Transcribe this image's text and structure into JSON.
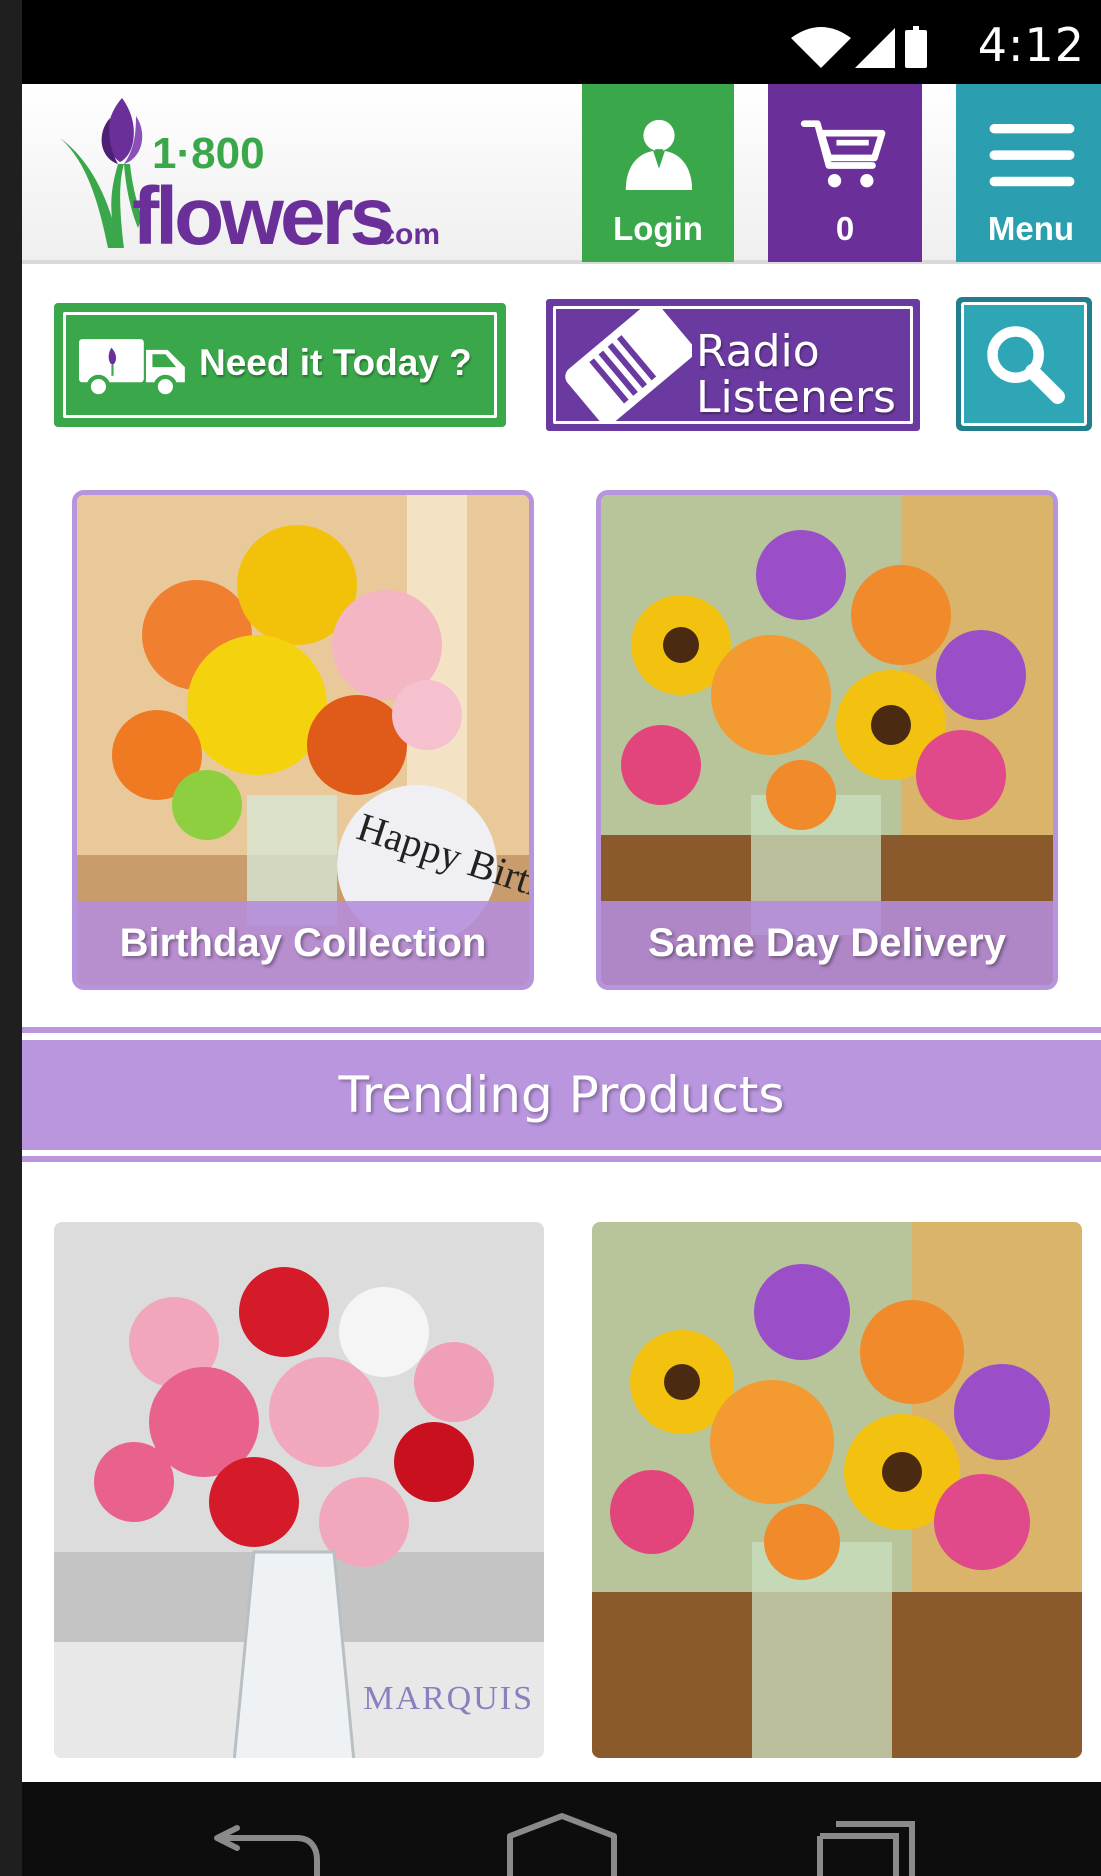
{
  "status_bar": {
    "time": "4:12",
    "icons": [
      "wifi-icon",
      "signal-icon",
      "battery-icon"
    ]
  },
  "header": {
    "logo": {
      "number": "1·800",
      "word": "flowers",
      "suffix": ".com"
    },
    "login_label": "Login",
    "cart_count": "0",
    "menu_label": "Menu"
  },
  "actions": {
    "need_today_label": "Need it Today ?",
    "radio_line1": "Radio",
    "radio_line2": "Listeners",
    "search_icon": "search-icon"
  },
  "categories": [
    {
      "label": "Birthday Collection",
      "balloon_text": "Happy Birthday"
    },
    {
      "label": "Same Day Delivery"
    }
  ],
  "trending": {
    "title": "Trending Products"
  },
  "products": [
    {
      "brand": "MARQUIS"
    },
    {
      "brand": ""
    }
  ],
  "colors": {
    "green": "#3aa84a",
    "purple": "#6a2f98",
    "teal": "#2b9fb0",
    "lavender": "#b996de"
  },
  "nav": {
    "icons": [
      "back-icon",
      "home-icon",
      "recent-apps-icon"
    ]
  }
}
